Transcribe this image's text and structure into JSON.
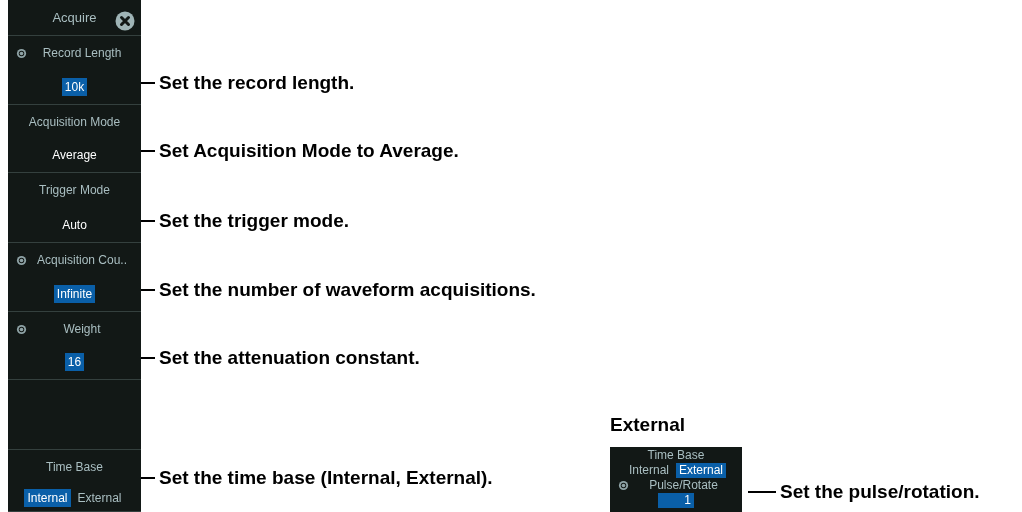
{
  "panel": {
    "title": "Acquire",
    "items": [
      {
        "kind": "value",
        "label": "Record Length",
        "jog": true,
        "value": "10k",
        "highlighted": true,
        "callout": "Set the record length."
      },
      {
        "kind": "value",
        "label": "Acquisition Mode",
        "jog": false,
        "value": "Average",
        "highlighted": false,
        "callout": "Set Acquisition Mode to Average."
      },
      {
        "kind": "value",
        "label": "Trigger Mode",
        "jog": false,
        "value": "Auto",
        "highlighted": false,
        "callout": "Set the trigger mode."
      },
      {
        "kind": "value",
        "label": "Acquisition Cou..",
        "jog": true,
        "value": "Infinite",
        "highlighted": true,
        "callout": "Set the number of waveform acquisitions."
      },
      {
        "kind": "value",
        "label": "Weight",
        "jog": true,
        "value": "16",
        "highlighted": true,
        "callout": "Set the attenuation constant."
      },
      {
        "kind": "empty"
      },
      {
        "kind": "options",
        "label": "Time Base",
        "options": [
          {
            "label": "Internal",
            "selected": true
          },
          {
            "label": "External",
            "selected": false
          }
        ],
        "callout": "Set the time base (Internal, External)."
      }
    ]
  },
  "external": {
    "heading": "External",
    "label": "Time Base",
    "options": [
      {
        "label": "Internal",
        "selected": false
      },
      {
        "label": "External",
        "selected": true
      }
    ],
    "sub": {
      "label": "Pulse/Rotate",
      "jog": true,
      "value": "1",
      "highlighted": true
    },
    "callout": "Set the pulse/rotation."
  }
}
